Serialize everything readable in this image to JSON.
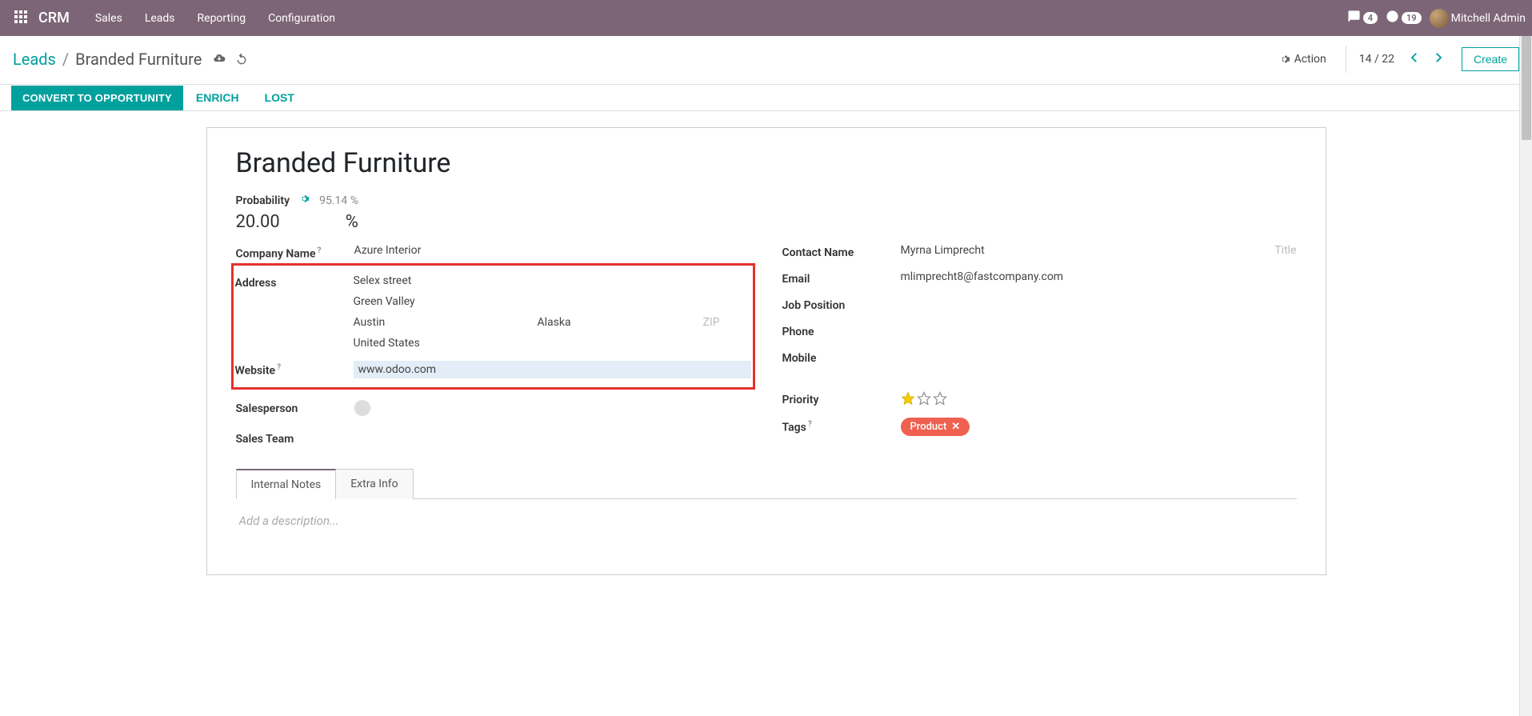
{
  "nav": {
    "brand": "CRM",
    "items": [
      "Sales",
      "Leads",
      "Reporting",
      "Configuration"
    ],
    "conversations_count": "4",
    "activities_count": "19",
    "user_name": "Mitchell Admin"
  },
  "breadcrumb": {
    "parent": "Leads",
    "current": "Branded Furniture"
  },
  "control": {
    "action_label": "Action",
    "pager": "14 / 22",
    "create_label": "Create"
  },
  "buttons": {
    "convert": "CONVERT TO OPPORTUNITY",
    "enrich": "ENRICH",
    "lost": "LOST"
  },
  "record": {
    "title": "Branded Furniture",
    "probability_label": "Probability",
    "probability_auto": "95.14 %",
    "probability_value": "20.00",
    "percent_sign": "%",
    "company_label": "Company Name",
    "company_value": "Azure Interior",
    "address_label": "Address",
    "street": "Selex street",
    "street2": "Green Valley",
    "city": "Austin",
    "state": "Alaska",
    "zip_placeholder": "ZIP",
    "country": "United States",
    "website_label": "Website",
    "website_value": "www.odoo.com",
    "salesperson_label": "Salesperson",
    "salesteam_label": "Sales Team",
    "contact_name_label": "Contact Name",
    "contact_name_value": "Myrna Limprecht",
    "title_placeholder": "Title",
    "email_label": "Email",
    "email_value": "mlimprecht8@fastcompany.com",
    "job_label": "Job Position",
    "phone_label": "Phone",
    "mobile_label": "Mobile",
    "priority_label": "Priority",
    "priority_value": 1,
    "tags_label": "Tags",
    "tags": [
      "Product"
    ]
  },
  "tabs": {
    "notes": "Internal Notes",
    "extra": "Extra Info",
    "notes_placeholder": "Add a description..."
  }
}
